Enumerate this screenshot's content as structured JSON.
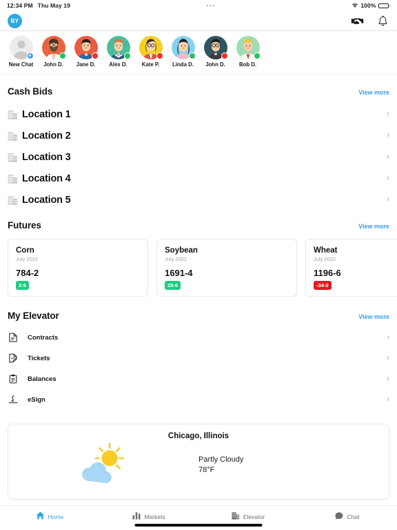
{
  "status_bar": {
    "time": "12:34 PM",
    "date": "Thu May 19",
    "center_dots": "•••",
    "battery_percent": "100%",
    "wifi_icon": "wifi-icon",
    "battery_icon": "battery-full-icon"
  },
  "app_bar": {
    "avatar_initials": "BY",
    "handshake_icon": "handshake-icon",
    "bell_icon": "bell-icon",
    "accent_color": "#2fa8dd"
  },
  "chat_strip": {
    "people": [
      {
        "name": "New Chat",
        "badge": "add",
        "badge_glyph": "+",
        "avatar": "new-chat-placeholder"
      },
      {
        "name": "John D.",
        "badge": "online",
        "avatar": "avatar-bearded-man"
      },
      {
        "name": "Jane D.",
        "badge": "busy",
        "avatar": "avatar-short-hair-person"
      },
      {
        "name": "Alex D.",
        "badge": "online",
        "avatar": "avatar-redhead-man"
      },
      {
        "name": "Kate P.",
        "badge": "busy",
        "avatar": "avatar-woman-glasses"
      },
      {
        "name": "Linda D.",
        "badge": "online",
        "avatar": "avatar-long-hair-woman"
      },
      {
        "name": "John D.",
        "badge": "busy",
        "avatar": "avatar-man-glasses"
      },
      {
        "name": "Bob D.",
        "badge": "online",
        "avatar": "avatar-man-tie"
      }
    ]
  },
  "cash_bids": {
    "title": "Cash Bids",
    "view_more": "View more",
    "locations": [
      {
        "name": "Location 1"
      },
      {
        "name": "Location 2"
      },
      {
        "name": "Location 3"
      },
      {
        "name": "Location 4"
      },
      {
        "name": "Location 5"
      }
    ]
  },
  "futures": {
    "title": "Futures",
    "view_more": "View more",
    "cards": [
      {
        "commodity": "Corn",
        "month": "July 2022",
        "price": "784-2",
        "change": "2-6",
        "direction": "up"
      },
      {
        "commodity": "Soybean",
        "month": "July 2022",
        "price": "1691-4",
        "change": "28-6",
        "direction": "up"
      },
      {
        "commodity": "Wheat",
        "month": "July 2022",
        "price": "1196-6",
        "change": "-34-0",
        "direction": "down"
      }
    ],
    "up_color": "#1ecd81",
    "down_color": "#e01b22"
  },
  "my_elevator": {
    "title": "My Elevator",
    "view_more": "View more",
    "items": [
      {
        "label": "Contracts",
        "icon": "document-icon"
      },
      {
        "label": "Tickets",
        "icon": "document-edit-icon"
      },
      {
        "label": "Balances",
        "icon": "clipboard-icon"
      },
      {
        "label": "eSign",
        "icon": "signature-icon"
      }
    ]
  },
  "weather": {
    "city": "Chicago, Illinois",
    "condition": "Partly Cloudy",
    "temperature": "78°F",
    "icon": "sun-behind-cloud-icon"
  },
  "tab_bar": {
    "tabs": [
      {
        "label": "Home",
        "icon": "home-icon",
        "active": true
      },
      {
        "label": "Markets",
        "icon": "bar-chart-icon",
        "active": false
      },
      {
        "label": "Elevator",
        "icon": "building-icon",
        "active": false
      },
      {
        "label": "Chat",
        "icon": "chat-bubble-icon",
        "active": false
      }
    ],
    "active_color": "#2fa8dd"
  }
}
